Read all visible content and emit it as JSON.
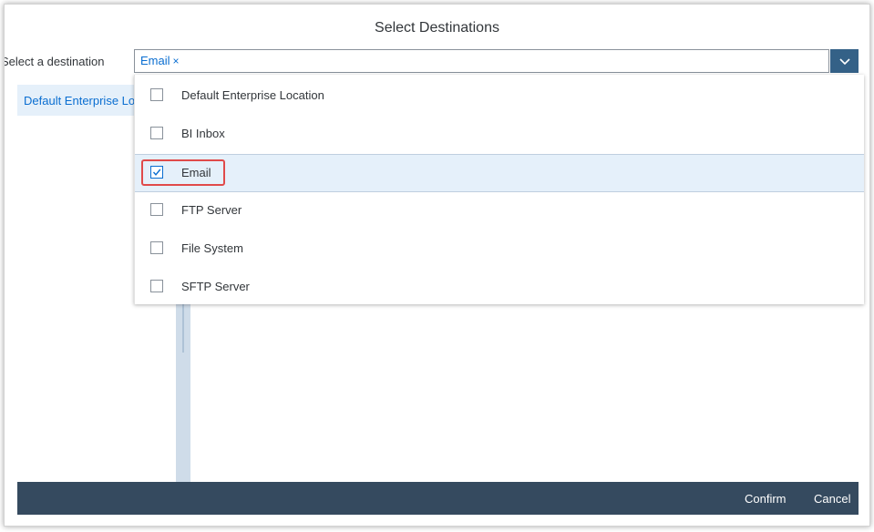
{
  "dialog": {
    "title": "Select Destinations",
    "field_label": "Select a destination",
    "token_label": "Email",
    "token_remove": "×",
    "left_panel_item": "Default Enterprise Location"
  },
  "options": [
    {
      "label": "Default Enterprise Location",
      "checked": false
    },
    {
      "label": "BI Inbox",
      "checked": false
    },
    {
      "label": "Email",
      "checked": true
    },
    {
      "label": "FTP Server",
      "checked": false
    },
    {
      "label": "File System",
      "checked": false
    },
    {
      "label": "SFTP Server",
      "checked": false
    }
  ],
  "footer": {
    "confirm": "Confirm",
    "cancel": "Cancel"
  },
  "icons": {
    "dropdown": "chevron-down-icon",
    "check": "checkmark-icon",
    "remove": "close-icon"
  },
  "colors": {
    "accent": "#0a6ed1",
    "footer_bg": "#354a5f",
    "dropdown_btn": "#346187",
    "selected_bg": "#e5f0fa",
    "highlight": "#e04a4a"
  }
}
